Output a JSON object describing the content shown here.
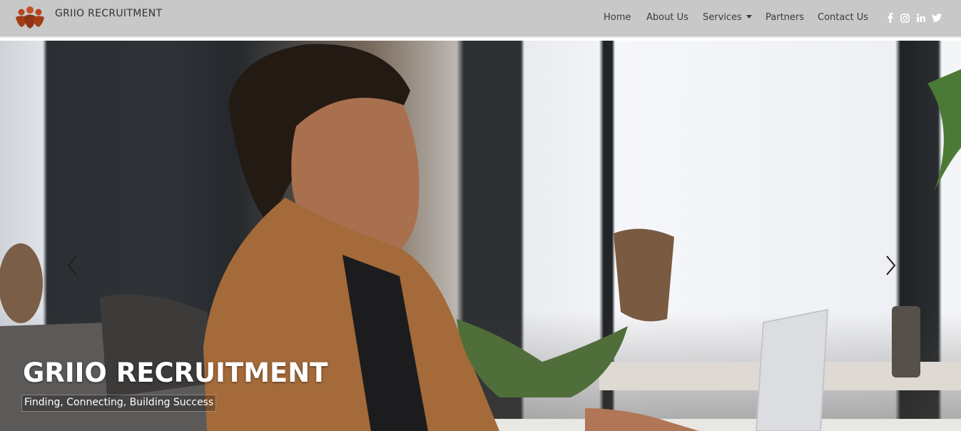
{
  "header": {
    "brand_name": "GRIIO RECRUITMENT",
    "nav": [
      {
        "label": "Home"
      },
      {
        "label": "About Us"
      },
      {
        "label": "Services",
        "has_dropdown": true
      },
      {
        "label": "Partners"
      },
      {
        "label": "Contact Us"
      }
    ],
    "social_icons": [
      "facebook-icon",
      "instagram-icon",
      "linkedin-icon",
      "twitter-icon"
    ]
  },
  "hero": {
    "title": "GRIIO RECRUITMENT",
    "tagline": "Finding, Connecting, Building Success",
    "controls": [
      "carousel-prev-icon",
      "carousel-next-icon"
    ]
  },
  "colors": {
    "navbar_bg": "#c8c8c8",
    "nav_text": "#3a3a3a",
    "logo_accent": "#b8461c",
    "hero_text": "#ffffff"
  }
}
